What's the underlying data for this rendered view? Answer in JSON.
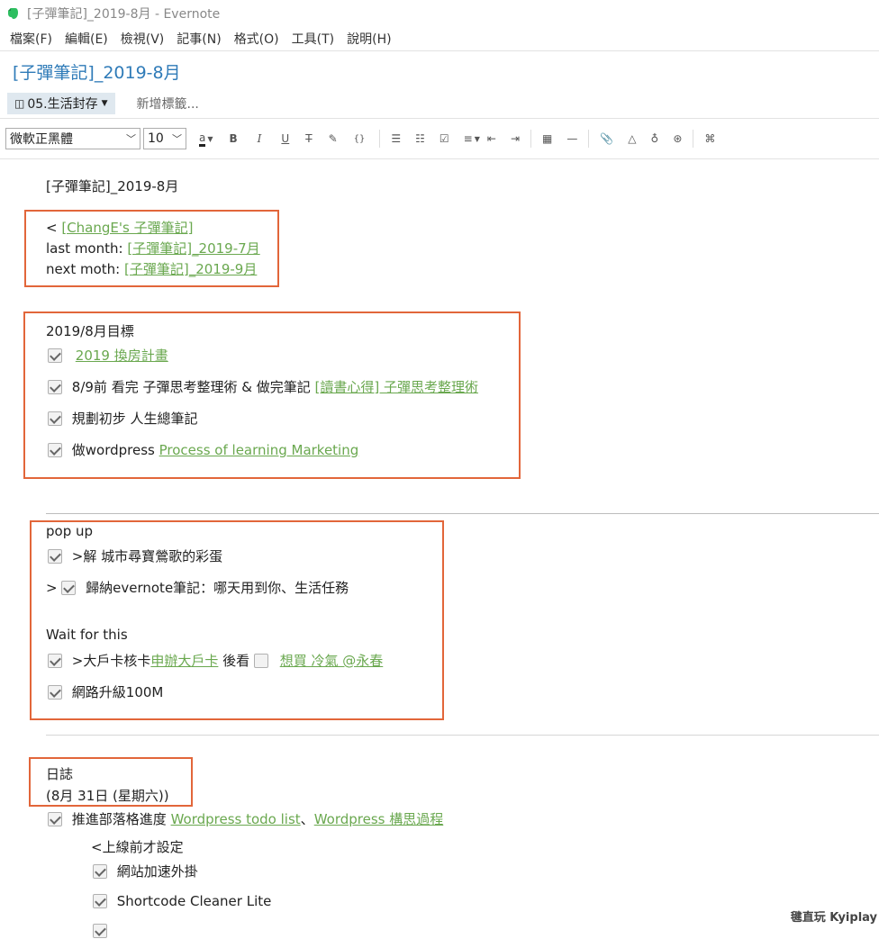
{
  "window": {
    "title": "[子彈筆記]_2019-8月 - Evernote"
  },
  "menu": [
    "檔案(F)",
    "編輯(E)",
    "檢視(V)",
    "記事(N)",
    "格式(O)",
    "工具(T)",
    "說明(H)"
  ],
  "note": {
    "title": "[子彈筆記]_2019-8月",
    "notebook": "05.生活封存",
    "add_tag": "新增標籤..."
  },
  "toolbar": {
    "font": "微軟正黑體",
    "size": "10",
    "buttons": {
      "font_color": "a",
      "bold": "B",
      "italic": "I",
      "underline": "U",
      "strike": "T",
      "highlight": "✎",
      "code": "{}",
      "shortcut": "⌘"
    }
  },
  "body": {
    "heading": "[子彈筆記]_2019-8月",
    "nav": {
      "prefix": "< ",
      "home_link": "[ChangE's 子彈筆記]",
      "last_label": "last month: ",
      "last_link": "[子彈筆記]_2019-7月",
      "next_label": "next moth: ",
      "next_link": "[子彈筆記]_2019-9月"
    },
    "goals": {
      "title": "2019/8月目標",
      "items": [
        {
          "text": "",
          "link": "2019 換房計畫"
        },
        {
          "text": "8/9前 看完 子彈思考整理術 & 做完筆記  ",
          "link": "[讀書心得] 子彈思考整理術"
        },
        {
          "text": "規劃初步 人生總筆記",
          "link": ""
        },
        {
          "text": "做wordpress   ",
          "link": "Process of learning Marketing"
        }
      ]
    },
    "popup": {
      "title": "pop up",
      "item1": ">解 城市尋寶鶯歌的彩蛋",
      "item2_prefix": ">",
      "item2": "歸納evernote筆記：哪天用到你、生活任務",
      "wait_title": "Wait for this",
      "item3_text": ">大戶卡核卡",
      "item3_link": "申辦大戶卡",
      "item3_mid": " 後看",
      "item3_link2": "想買 冷氣 @永春",
      "item4": "網路升級100M"
    },
    "journal": {
      "title": "日誌",
      "date": "(8月 31日 (星期六))",
      "item1_text": "推進部落格進度 ",
      "item1_link1": "Wordpress todo list",
      "item1_sep": "、",
      "item1_link2": "Wordpress 構思過程",
      "sub_title": "<上線前才設定",
      "sub1": "網站加速外掛",
      "sub2": "Shortcode Cleaner Lite"
    }
  },
  "watermark": "毽直玩 Kyiplay"
}
